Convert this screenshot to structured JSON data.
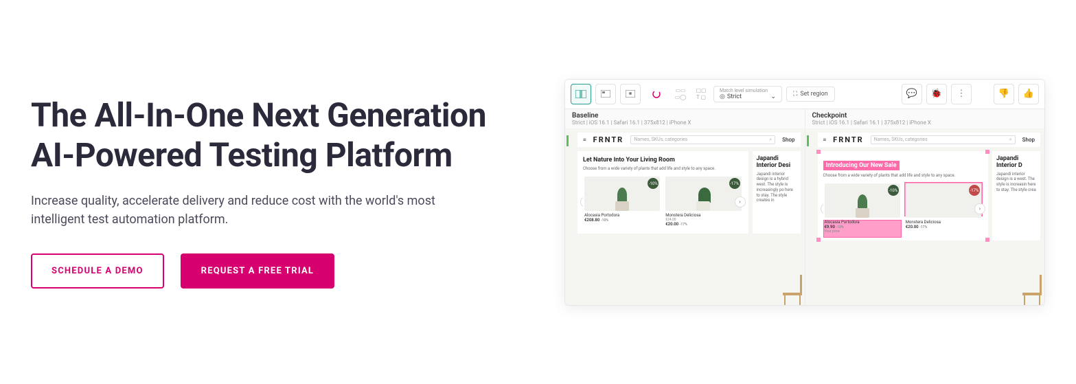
{
  "hero": {
    "title": "The All-In-One Next Generation AI-Powered Testing Platform",
    "subtitle": "Increase quality, accelerate delivery and reduce cost with the world's most intelligent test automation platform.",
    "cta_demo": "SCHEDULE A DEMO",
    "cta_trial": "REQUEST A FREE TRIAL"
  },
  "toolbar": {
    "match_label": "Match level simulation",
    "match_value": "Strict",
    "region_label": "Set region"
  },
  "panels": {
    "baseline": {
      "title": "Baseline",
      "meta": "Strict  |  iOS 16.1  |  Safari 16.1  |  375x812  |  iPhone X"
    },
    "checkpoint": {
      "title": "Checkpoint",
      "meta": "Strict  |  iOS 16.1  |  Safari 16.1  |  375x812  |  iPhone X"
    }
  },
  "mock": {
    "logo": "FRNTR",
    "search_placeholder": "Names, SKUs, categories",
    "nav": "Shop",
    "baseline_heading": "Let Nature Into Your Living Room",
    "checkpoint_heading": "Introducing Our New Sale",
    "card_text": "Choose from a wide variety of plants that add life and style to any space.",
    "card2_title": "Japandi Interior Desi",
    "card2_title_b": "Japandi Interior D",
    "card2_text": "Japandi interior design is a hybrid west. The style is increasingly po here to stay. The style creates in",
    "card2_text_b": "Japandi interior design is a west. The style is increasin here to stay. The style crea",
    "prod1_name": "Alocasia Portodora",
    "prod1_price": "€208.80",
    "prod1_old": "-10%",
    "prod1_badge": "-10%",
    "prod2_name": "Monstera Deliciosa",
    "prod2_price": "€20.00",
    "prod2_old": "€24.00",
    "prod2_disc": "-17%",
    "prod2_badge": "-17%",
    "chk_prod1_price": "€9.90",
    "chk_prod1_disc": "-10%",
    "chk_your_price": "Your price"
  }
}
